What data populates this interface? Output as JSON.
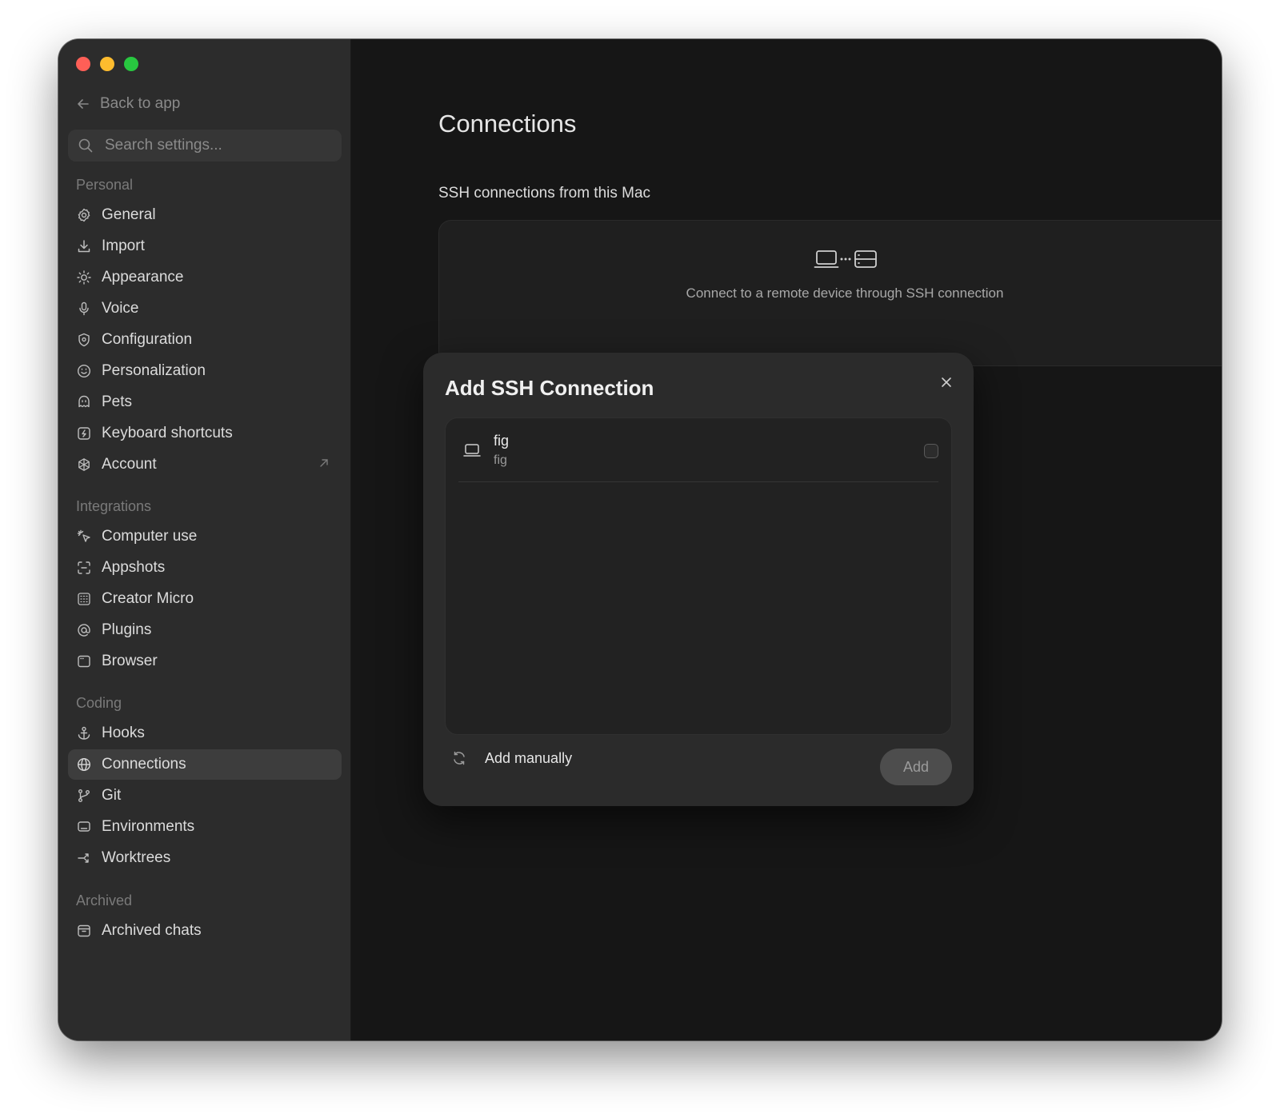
{
  "sidebar": {
    "back_label": "Back to app",
    "search_placeholder": "Search settings...",
    "sections": {
      "personal": "Personal",
      "integrations": "Integrations",
      "coding": "Coding",
      "archived": "Archived"
    },
    "personal_items": {
      "general": "General",
      "import": "Import",
      "appearance": "Appearance",
      "voice": "Voice",
      "configuration": "Configuration",
      "personalization": "Personalization",
      "pets": "Pets",
      "keyboard_shortcuts": "Keyboard shortcuts",
      "account": "Account"
    },
    "integration_items": {
      "computer_use": "Computer use",
      "appshots": "Appshots",
      "creator_micro": "Creator Micro",
      "plugins": "Plugins",
      "browser": "Browser"
    },
    "coding_items": {
      "hooks": "Hooks",
      "connections": "Connections",
      "git": "Git",
      "environments": "Environments",
      "worktrees": "Worktrees"
    },
    "archived_items": {
      "archived_chats": "Archived chats"
    },
    "active_item": "Connections"
  },
  "main": {
    "title": "Connections",
    "subtitle": "SSH connections from this Mac",
    "empty_state_text": "Connect to a remote device through SSH connection"
  },
  "modal": {
    "title": "Add SSH Connection",
    "hosts": [
      {
        "name": "fig",
        "sub": "fig",
        "checked": false
      }
    ],
    "add_manually_label": "Add manually",
    "add_button_label": "Add"
  },
  "colors": {
    "window_bg": "#161616",
    "sidebar_bg": "#2c2c2c",
    "modal_bg": "#2b2b2b",
    "traffic_red": "#fe5f57",
    "traffic_yellow": "#febc2e",
    "traffic_green": "#28c840"
  }
}
